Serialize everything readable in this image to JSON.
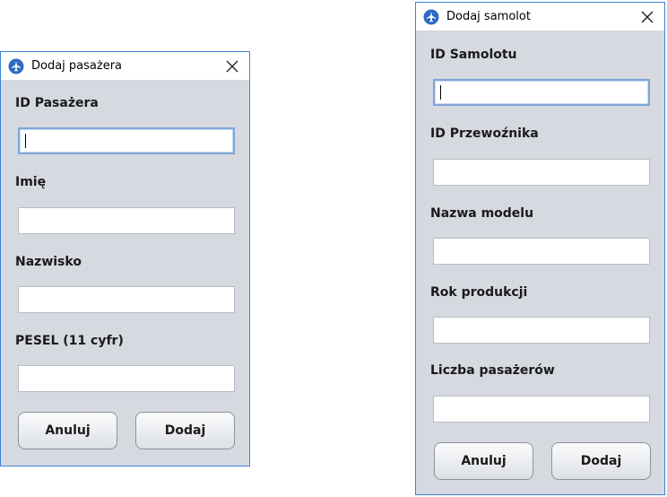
{
  "passenger_dialog": {
    "title": "Dodaj pasażera",
    "fields": [
      {
        "label": "ID Pasażera",
        "value": ""
      },
      {
        "label": "Imię",
        "value": ""
      },
      {
        "label": "Nazwisko",
        "value": ""
      },
      {
        "label": "PESEL (11 cyfr)",
        "value": ""
      }
    ],
    "cancel_label": "Anuluj",
    "submit_label": "Dodaj"
  },
  "plane_dialog": {
    "title": "Dodaj samolot",
    "fields": [
      {
        "label": "ID Samolotu",
        "value": ""
      },
      {
        "label": "ID Przewoźnika",
        "value": ""
      },
      {
        "label": "Nazwa modelu",
        "value": ""
      },
      {
        "label": "Rok produkcji",
        "value": ""
      },
      {
        "label": "Liczba pasażerów",
        "value": ""
      }
    ],
    "cancel_label": "Anuluj",
    "submit_label": "Dodaj"
  },
  "colors": {
    "window_border": "#3b84d6",
    "dialog_background": "#d6d9df",
    "focus_border": "#7ea6d8"
  },
  "icons": {
    "app": "airplane-app-icon",
    "close": "close-icon"
  }
}
